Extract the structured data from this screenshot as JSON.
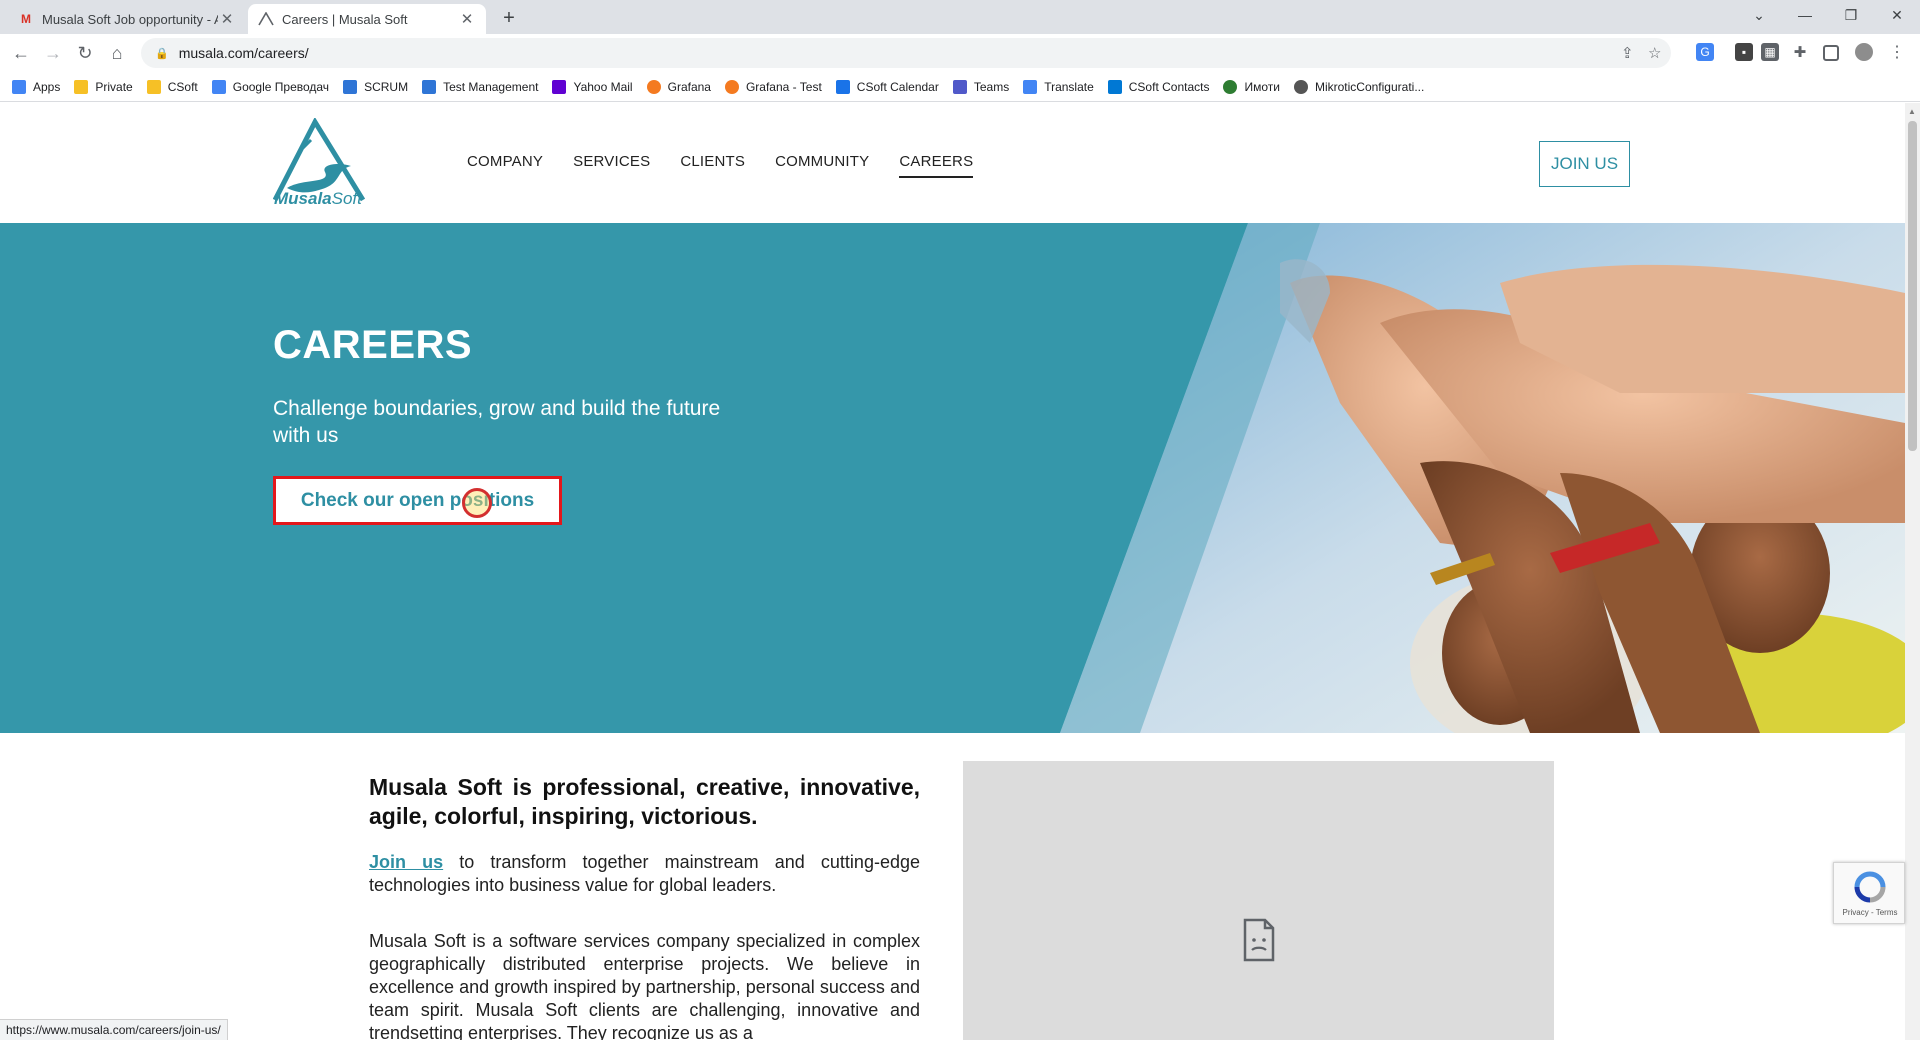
{
  "browser": {
    "tabs": [
      {
        "title": "Musala Soft Job opportunity - Au",
        "close": "✕",
        "favicon": "gmail-icon"
      },
      {
        "title": "Careers | Musala Soft",
        "close": "✕",
        "favicon": "musala-icon"
      }
    ],
    "new_tab": "+",
    "url": "musala.com/careers/",
    "bookmarks": [
      {
        "label": "Apps",
        "color": "#4285f4"
      },
      {
        "label": "Private",
        "color": "#f6c026"
      },
      {
        "label": "CSoft",
        "color": "#f6c026"
      },
      {
        "label": "Google Преводач",
        "color": "#4285f4"
      },
      {
        "label": "SCRUM",
        "color": "#2f75d6"
      },
      {
        "label": "Test Management",
        "color": "#2f75d6"
      },
      {
        "label": "Yahoo Mail",
        "color": "#6001d2"
      },
      {
        "label": "Grafana",
        "color": "#f47a20"
      },
      {
        "label": "Grafana - Test",
        "color": "#f47a20"
      },
      {
        "label": "CSoft Calendar",
        "color": "#1a73e8"
      },
      {
        "label": "Teams",
        "color": "#5059c9"
      },
      {
        "label": "Translate",
        "color": "#4285f4"
      },
      {
        "label": "CSoft Contacts",
        "color": "#0078d4"
      },
      {
        "label": "Имоти",
        "color": "#2e7d32"
      },
      {
        "label": "MikroticConfigurati...",
        "color": "#555555"
      }
    ],
    "status_url": "https://www.musala.com/careers/join-us/"
  },
  "site": {
    "logo": {
      "brand_bold": "Musala",
      "brand_light": "Soft"
    },
    "nav": [
      {
        "label": "COMPANY"
      },
      {
        "label": "SERVICES"
      },
      {
        "label": "CLIENTS"
      },
      {
        "label": "COMMUNITY"
      },
      {
        "label": "CAREERS",
        "current": true
      }
    ],
    "join_button": "JOIN US"
  },
  "hero": {
    "title": "CAREERS",
    "subtitle": "Challenge boundaries, grow and build the future with us",
    "cta": "Check our open positions"
  },
  "content": {
    "headline": "Musala Soft is professional, creative, innovative, agile, colorful, inspiring, victorious.",
    "join_link": "Join us",
    "para1_rest": " to transform together mainstream and cutting-edge technologies into business value for global leaders.",
    "para2": "Musala Soft is a software services company specialized in complex geographically distributed enterprise projects. We believe in excellence and growth inspired by partnership, personal success and team spirit. Musala Soft clients are challenging, innovative and trendsetting enterprises. They recognize us as a"
  },
  "recaptcha": {
    "text": "Privacy - Terms"
  },
  "colors": {
    "brand": "#2e8fa3",
    "hero_bg": "#3597aa",
    "highlight_border": "#e3171b"
  }
}
